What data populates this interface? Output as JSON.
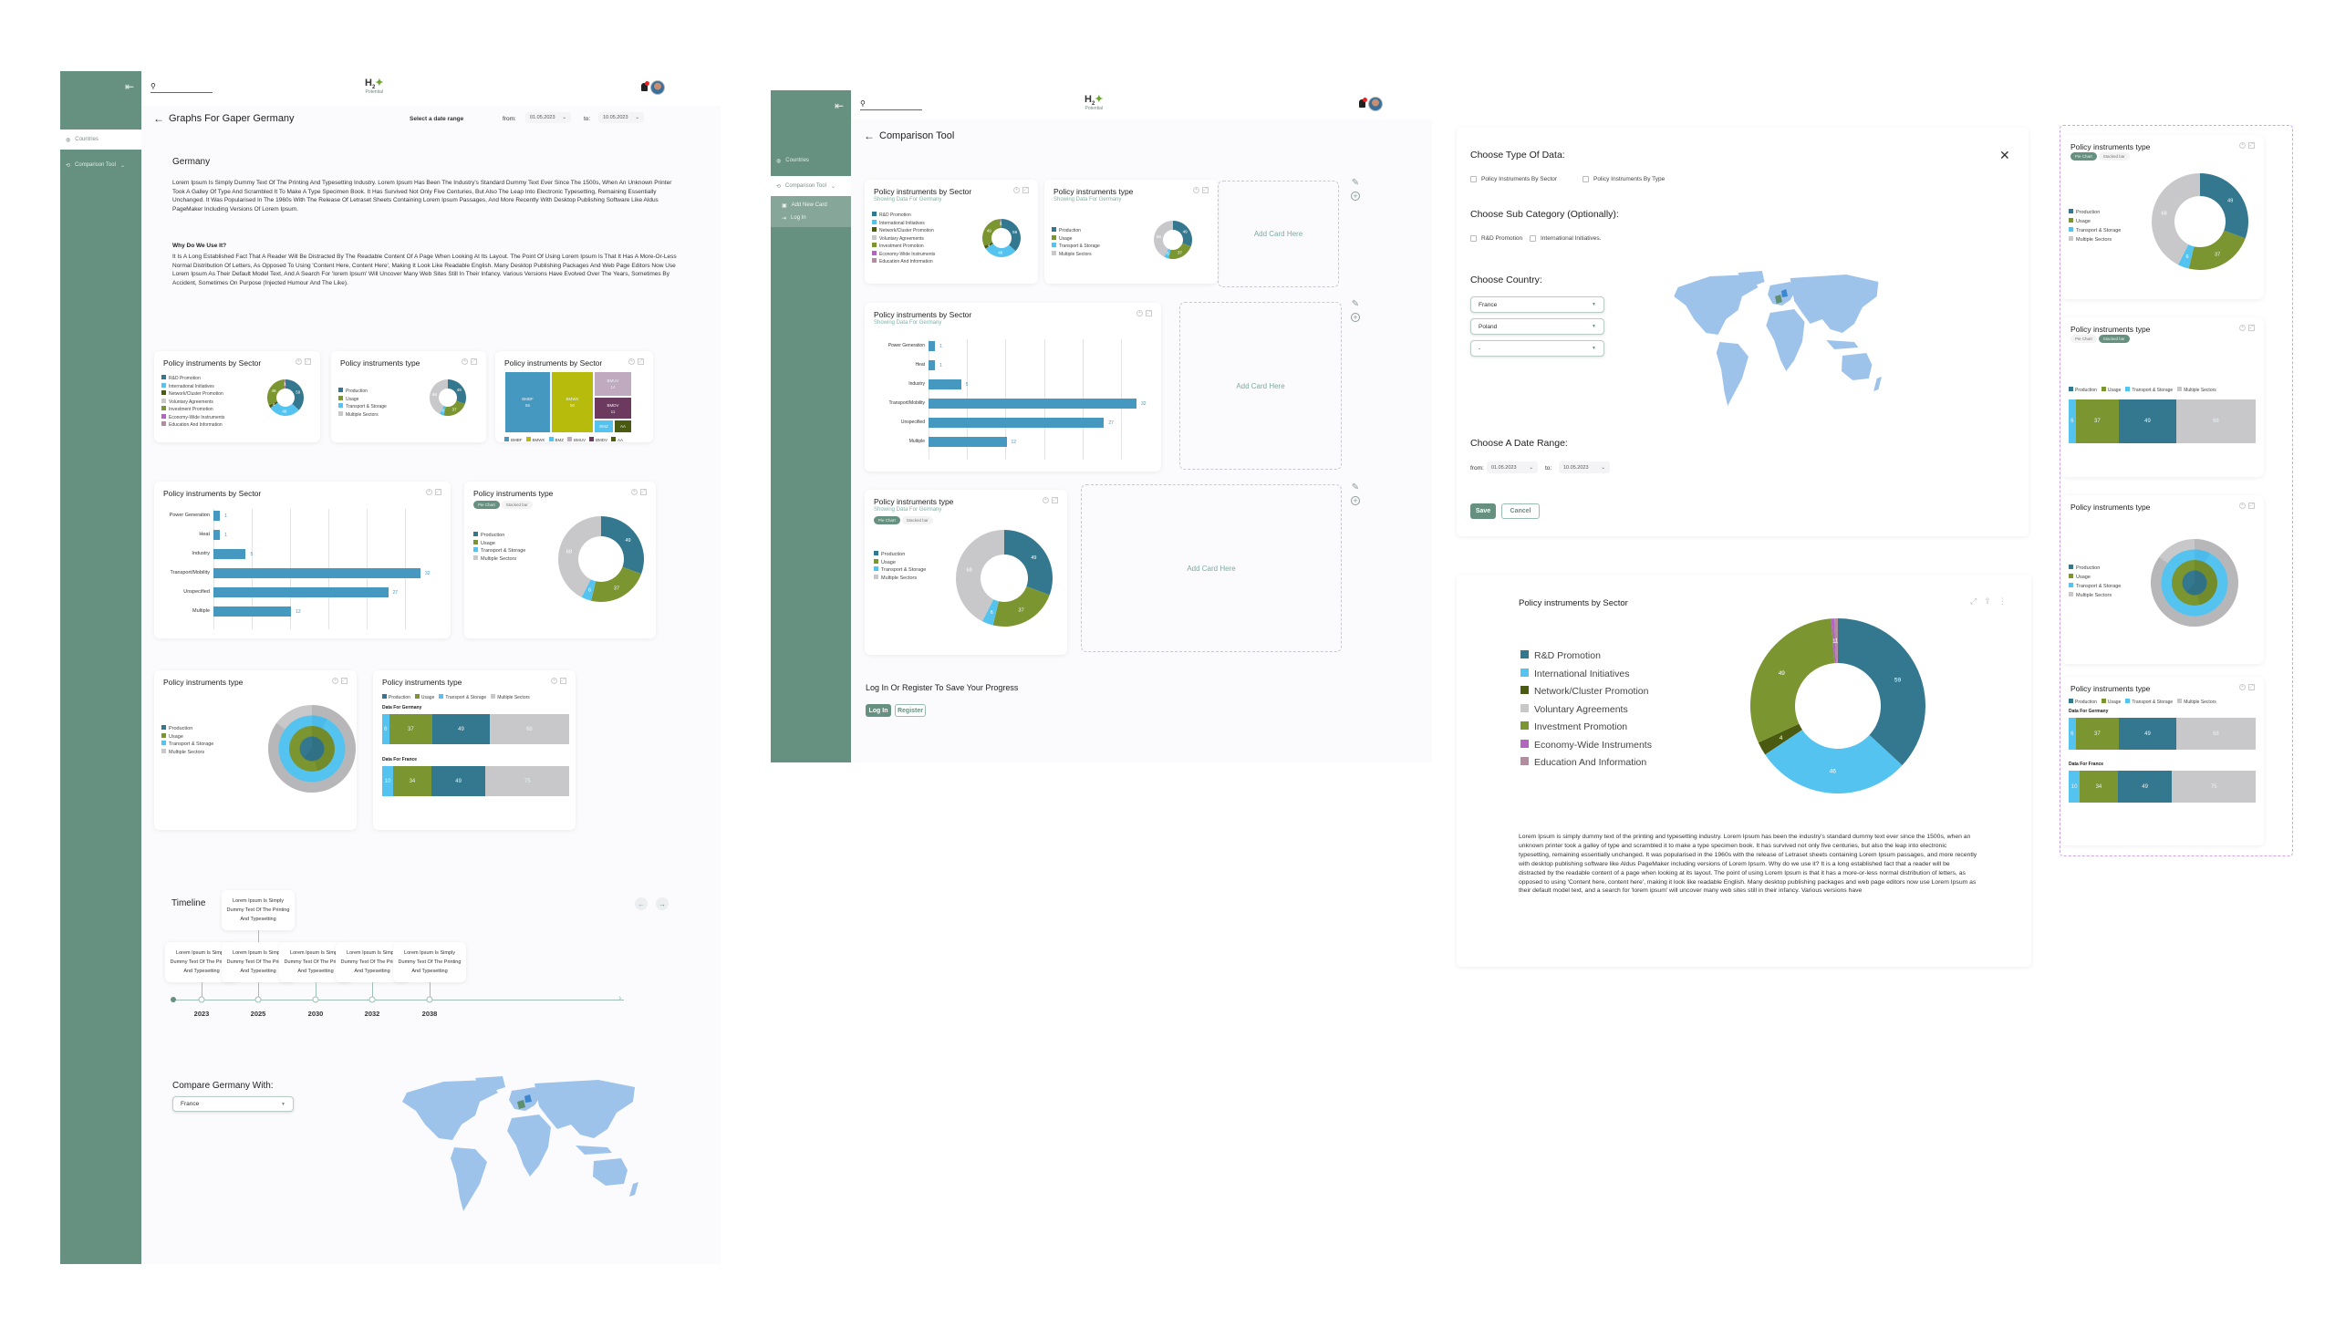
{
  "app": {
    "logo_main": "H",
    "logo_sub": "2",
    "logo_tagline": "Potential",
    "search_placeholder": "",
    "colors": {
      "brand": "#66907f",
      "production": "#34788f",
      "usage": "#7b9530",
      "transport": "#55c3f0",
      "multiple": "#c8c8ca",
      "network": "#4a5a10",
      "economy": "#b366c0",
      "education": "#b08ea0",
      "bar": "#4598c0"
    }
  },
  "icons": {
    "search": "search-icon",
    "bell": "bell-icon",
    "avatar": "avatar",
    "collapse": "collapse-sidebar-icon",
    "back": "arrow-left-icon",
    "globe": "globe-icon",
    "compare": "compare-icon",
    "chevron": "chevron-down-icon",
    "add_card": "add-card-icon",
    "login": "login-icon",
    "pen": "pencil-icon",
    "plus": "plus-circle-icon",
    "close": "close-icon",
    "zoom": "zoom-in-icon",
    "expand": "expand-icon",
    "share": "share-icon",
    "more": "more-vertical-icon"
  },
  "sidebar": {
    "items": [
      {
        "label": "Countries",
        "icon": "globe-icon"
      },
      {
        "label": "Comparison Tool",
        "icon": "compare-icon"
      }
    ],
    "sub_items": [
      {
        "label": "Add New Card",
        "icon": "add-card-icon"
      },
      {
        "label": "Log In",
        "icon": "login-icon"
      }
    ]
  },
  "screen1": {
    "title": "Graphs For Gaper Germany",
    "date_range_label": "Select a date range",
    "from_label": "from:",
    "from_value": "01.05.2023",
    "to_label": "to:",
    "to_value": "10.05.2023",
    "country_heading": "Germany",
    "intro": "Lorem Ipsum Is Simply Dummy Text Of The Printing And Typesetting Industry. Lorem Ipsum Has Been The Industry's Standard Dummy Text Ever Since The 1500s, When An Unknown Printer Took A Galley Of Type And Scrambled It To Make A Type Specimen Book. It Has Survived Not Only Five Centuries, But Also The Leap Into Electronic Typesetting, Remaining Essentially Unchanged. It Was Popularised In The 1960s With The Release Of Letraset Sheets Containing Lorem Ipsum Passages, And More Recently With Desktop Publishing Software Like Aldus PageMaker Including Versions Of Lorem Ipsum.",
    "why_heading": "Why Do We Use It?",
    "why_text": "It Is A Long Established Fact That A Reader Will Be Distracted By The Readable Content Of A Page When Looking At Its Layout. The Point Of Using Lorem Ipsum Is That It Has A More-Or-Less Normal Distribution Of Letters, As Opposed To Using 'Content Here, Content Here', Making It Look Like Readable English. Many Desktop Publishing Packages And Web Page Editors Now Use Lorem Ipsum As Their Default Model Text, And A Search For 'lorem Ipsum' Will Uncover Many Web Sites Still In Their Infancy. Various Versions Have Evolved Over The Years, Sometimes By Accident, Sometimes On Purpose (Injected Humour And The Like).",
    "timeline": {
      "title": "Timeline",
      "events": [
        {
          "year": "2023",
          "text": "Lorem Ipsum Is Simply Dummy Text Of The Printing And Typesetting"
        },
        {
          "year": "2025",
          "text": "Lorem Ipsum Is Simply Dummy Text Of The Printing And Typesetting"
        },
        {
          "year": "2030",
          "text": "Lorem Ipsum Is Simply Dummy Text Of The Printing And Typesetting"
        },
        {
          "year": "2032",
          "text": "Lorem Ipsum Is Simply Dummy Text Of The Printing And Typesetting"
        },
        {
          "year": "2038",
          "text": "Lorem Ipsum Is Simply Dummy Text Of The Printing And Typesetting"
        }
      ],
      "extra_event": {
        "year": "2025",
        "text": "Lorem Ipsum Is Simply Dummy Text Of The Printing And Typesetting"
      }
    },
    "compare": {
      "label": "Compare Germany With:",
      "selected": "France"
    }
  },
  "screen2": {
    "title": "Comparison Tool",
    "add_card_label": "Add Card Here",
    "showing_label": "Showing Data For Germany",
    "save_prompt": "Log In Or Register To Save Your Progress",
    "login_label": "Log In",
    "register_label": "Register"
  },
  "modal": {
    "type_heading": "Choose Type Of Data:",
    "type_options": [
      "Policy Instruments By Sector",
      "Policy Instruments By Type"
    ],
    "sub_heading": "Choose Sub Category (Optionally):",
    "sub_options": [
      "R&D Promotion",
      "International Initiatives."
    ],
    "country_heading": "Choose Country:",
    "countries": [
      "France",
      "Poland",
      "-"
    ],
    "date_heading": "Choose A Date Range:",
    "from_label": "from:",
    "from_value": "01.05.2023",
    "to_label": "to:",
    "to_value": "10.05.2023",
    "save_label": "Save",
    "cancel_label": "Cancel"
  },
  "big_chart": {
    "paragraph": "Lorem Ipsum is simply dummy text of the printing and typesetting industry. Lorem Ipsum has been the industry's standard dummy text ever since the 1500s, when an unknown printer took a galley of type and scrambled it to make a type specimen book. It has survived not only five centuries, but also the leap into electronic typesetting, remaining essentially unchanged. It was popularised in the 1960s with the release of Letraset sheets containing Lorem Ipsum passages, and more recently with desktop publishing software like Aldus PageMaker including versions of Lorem Ipsum. Why do we use it? It is a long established fact that a reader will be distracted by the readable content of a page when looking at its layout. The point of using Lorem Ipsum is that it has a more-or-less normal distribution of letters, as opposed to using 'Content here, content here', making it look like readable English. Many desktop publishing packages and web page editors now use Lorem Ipsum as their default model text, and a search for 'lorem ipsum' will uncover many web sites still in their infancy. Various versions have"
  },
  "labels": {
    "pie_chart": "Pie Chart",
    "stacked_bar": "Stacked bar",
    "data_for_germany": "Data For Germany",
    "data_for_france": "Data For France"
  },
  "chart_data": [
    {
      "id": "sector_donut",
      "type": "pie",
      "title": "Policy instruments by Sector",
      "categories": [
        "R&D Promotion",
        "International Initiatives",
        "Network/Cluster Promotion",
        "Voluntary Agreements",
        "Investment Promotion",
        "Economy-Wide Instruments",
        "Education And Information"
      ],
      "values": [
        59,
        46,
        4,
        0,
        49,
        1,
        1
      ],
      "colors": [
        "#34788f",
        "#55c3f0",
        "#4a5a10",
        "#c8c8ca",
        "#7b9530",
        "#b366c0",
        "#b08ea0"
      ],
      "legend": "left"
    },
    {
      "id": "type_donut",
      "type": "pie",
      "title": "Policy instruments type",
      "categories": [
        "Production",
        "Usage",
        "Transport & Storage",
        "Multiple Sectors"
      ],
      "values": [
        49,
        37,
        6,
        68
      ],
      "colors": [
        "#34788f",
        "#7b9530",
        "#55c3f0",
        "#c8c8ca"
      ],
      "legend": "left"
    },
    {
      "id": "ministry_treemap",
      "type": "heatmap",
      "title": "Policy instruments by Sector",
      "categories": [
        "BMBF",
        "BMWK",
        "BMZ",
        "BMUV",
        "BMDV",
        "AA"
      ],
      "values": [
        56,
        50,
        3,
        14,
        11,
        3
      ],
      "colors": [
        "#4598c0",
        "#b7bb0c",
        "#55c3f0",
        "#c0aac0",
        "#6b3a5e",
        "#4a5a10"
      ],
      "legend": "bottom"
    },
    {
      "id": "sector_bars",
      "type": "bar",
      "title": "Policy instruments by Sector",
      "categories": [
        "Power Generation",
        "Heat",
        "Industry",
        "Transport/Mobility",
        "Unspecified",
        "Multiple"
      ],
      "values": [
        1,
        1,
        5,
        32,
        27,
        12
      ],
      "xlim": [
        0,
        32
      ],
      "grid": true
    },
    {
      "id": "type_stacked",
      "type": "bar",
      "title": "Policy instruments type",
      "categories": [
        "Transport & Storage",
        "Usage",
        "Production",
        "Multiple Sectors"
      ],
      "series": [
        {
          "name": "Data For Germany",
          "values": [
            6,
            37,
            49,
            68
          ]
        },
        {
          "name": "Data For France",
          "values": [
            10,
            34,
            49,
            75
          ]
        }
      ],
      "colors": [
        "#55c3f0",
        "#7b9530",
        "#34788f",
        "#c8c8ca"
      ],
      "legend": "top"
    },
    {
      "id": "type_rings",
      "type": "pie",
      "title": "Policy instruments type",
      "categories": [
        "Production",
        "Usage",
        "Transport & Storage",
        "Multiple Sectors"
      ],
      "values": [
        49,
        37,
        6,
        68
      ],
      "colors": [
        "#34788f",
        "#7b9530",
        "#55c3f0",
        "#c8c8ca"
      ],
      "legend": "left"
    }
  ]
}
